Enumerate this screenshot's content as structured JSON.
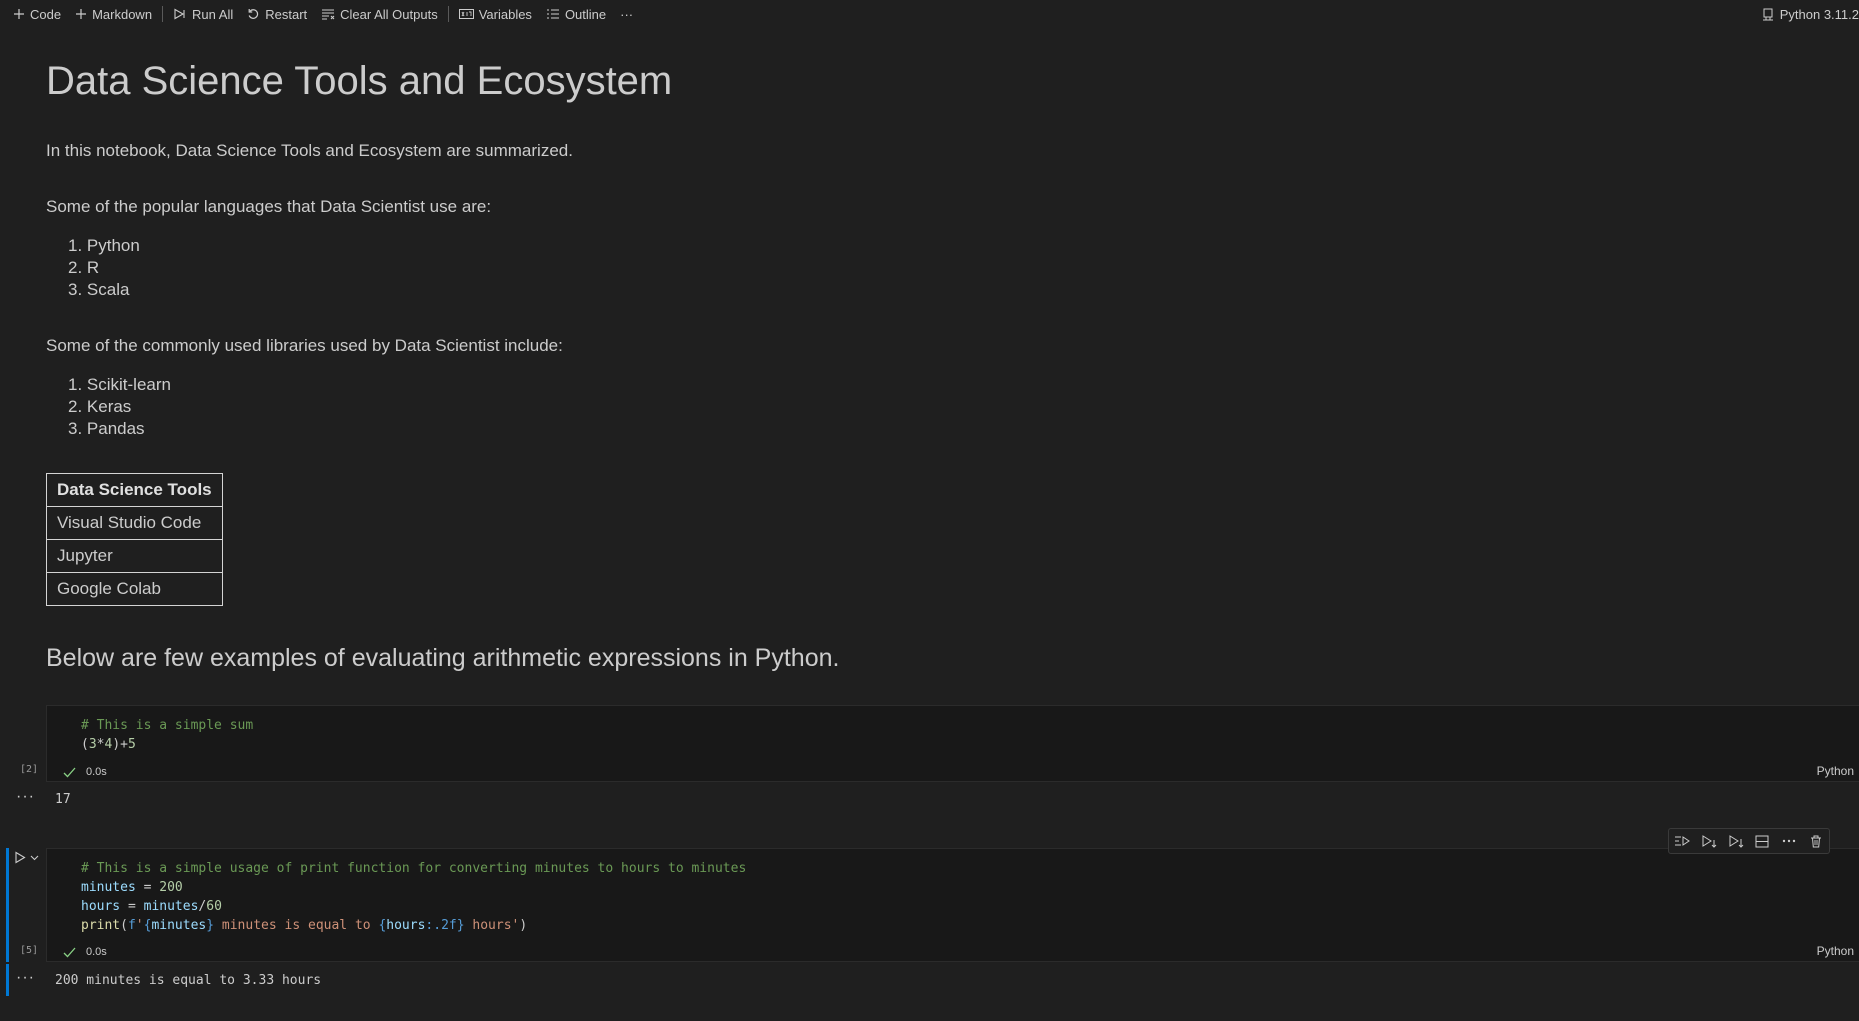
{
  "toolbar": {
    "code_label": "Code",
    "markdown_label": "Markdown",
    "run_all_label": "Run All",
    "restart_label": "Restart",
    "clear_outputs_label": "Clear All Outputs",
    "variables_label": "Variables",
    "outline_label": "Outline",
    "more_label": "···",
    "kernel_label": "Python 3.11.2"
  },
  "notebook": {
    "title": "Data Science Tools and Ecosystem",
    "intro": "In this notebook, Data Science Tools and Ecosystem are summarized.",
    "languages_intro": "Some of the popular languages that Data Scientist use are:",
    "languages": [
      "1. Python",
      "2. R",
      "3. Scala"
    ],
    "libraries_intro": "Some of the commonly used libraries used by Data Scientist include:",
    "libraries": [
      "1. Scikit-learn",
      "2. Keras",
      "3. Pandas"
    ],
    "table_header": "Data Science Tools",
    "table_rows": [
      "Visual Studio Code",
      "Jupyter",
      "Google Colab"
    ],
    "arith_heading": "Below are few examples of evaluating arithmetic expressions in Python."
  },
  "cells": [
    {
      "execution_count": "[2]",
      "exec_time": "0.0s",
      "language": "Python",
      "line1_comment": "# This is a simple sum",
      "line2_open": "(",
      "line2_a": "3",
      "line2_op1": "*",
      "line2_b": "4",
      "line2_close": ")+",
      "line2_c": "5",
      "output": "17",
      "output_marker": "···"
    },
    {
      "execution_count": "[5]",
      "exec_time": "0.0s",
      "language": "Python",
      "line1_comment": "# This is a simple usage of print function for converting minutes to hours to minutes",
      "line2_var": "minutes",
      "line2_eq": " = ",
      "line2_val": "200",
      "line3_var": "hours",
      "line3_eq": " = ",
      "line3_var2": "minutes",
      "line3_op": "/",
      "line3_val": "60",
      "line4_fn": "print",
      "line4_p1": "(",
      "line4_f": "f",
      "line4_s1": "'",
      "line4_b1": "{",
      "line4_v1": "minutes",
      "line4_b2": "}",
      "line4_s2": " minutes is equal to ",
      "line4_b3": "{",
      "line4_v2": "hours",
      "line4_fmt": ":.2f",
      "line4_b4": "}",
      "line4_s3": " hours'",
      "line4_p2": ")",
      "output": "200 minutes is equal to 3.33 hours",
      "output_marker": "···"
    }
  ],
  "colors": {
    "background": "#1f1f1f",
    "cell_background": "#181818",
    "selection_bar": "#0078d4",
    "comment": "#6a9955",
    "number": "#b5cea8",
    "string": "#ce9178"
  }
}
